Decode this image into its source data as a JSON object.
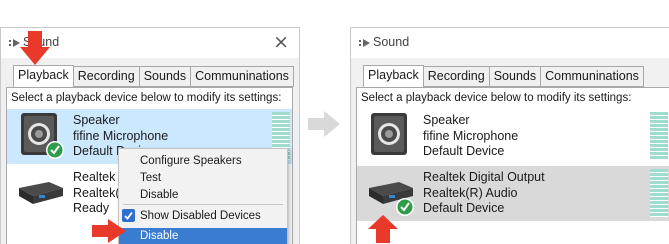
{
  "left_window": {
    "title": "Sound",
    "close_glyph": "×",
    "tabs": [
      "Playback",
      "Recording",
      "Sounds",
      "Communinations"
    ],
    "active_tab": "Playback",
    "instruction": "Select a playback device below to modify its settings:",
    "devices": [
      {
        "icon": "speaker-icon",
        "lines": [
          "Speaker",
          "fifine Microphone",
          "Default Device"
        ],
        "selected": true,
        "status": "default-check"
      },
      {
        "icon": "digital-output-icon",
        "lines": [
          "Realtek Digital Output",
          "Realtek(R) Audio",
          "Ready"
        ],
        "selected": false
      }
    ],
    "context_menu": {
      "items": [
        "Configure Speakers",
        "Test",
        "Disable",
        "Show Disabled Devices",
        "Disable"
      ],
      "checked_item": "Show Disabled Devices",
      "highlighted_item_index": 4
    }
  },
  "right_window": {
    "title": "Sound",
    "tabs": [
      "Playback",
      "Recording",
      "Sounds",
      "Communinations"
    ],
    "active_tab": "Playback",
    "instruction": "Select a playback device below to modify its settings:",
    "devices": [
      {
        "icon": "speaker-icon",
        "lines": [
          "Speaker",
          "fifine Microphone",
          "Default Device"
        ],
        "selected": false
      },
      {
        "icon": "digital-output-icon",
        "lines": [
          "Realtek Digital Output",
          "Realtek(R) Audio",
          "Default Device"
        ],
        "selected": true,
        "status": "default-check"
      }
    ]
  },
  "colors": {
    "annotation_arrow": "#e8392b",
    "selection": "#cce8ff",
    "menu_highlight": "#3a7cd0",
    "default_check": "#2e9c4a",
    "transition_arrow": "#d9d9d9"
  }
}
